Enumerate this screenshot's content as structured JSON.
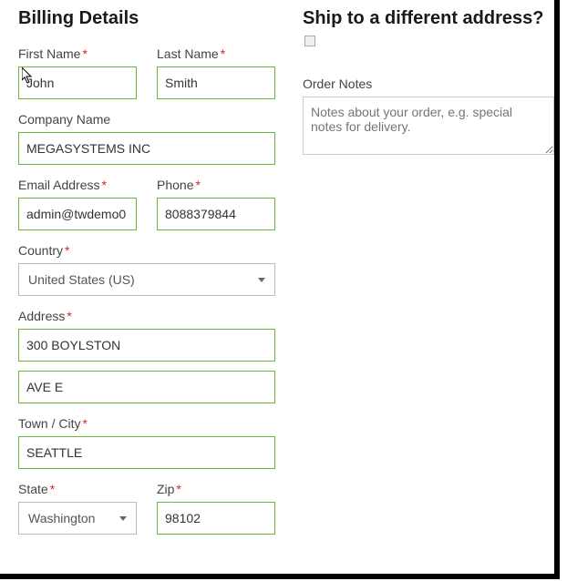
{
  "billing": {
    "heading": "Billing Details",
    "first_name": {
      "label": "First Name",
      "value": "John"
    },
    "last_name": {
      "label": "Last Name",
      "value": "Smith"
    },
    "company": {
      "label": "Company Name",
      "value": "MEGASYSTEMS INC"
    },
    "email": {
      "label": "Email Address",
      "value": "admin@twdemo0"
    },
    "phone": {
      "label": "Phone",
      "value": "8088379844"
    },
    "country": {
      "label": "Country",
      "selected": "United States (US)"
    },
    "address": {
      "label": "Address",
      "line1": "300 BOYLSTON",
      "line2": "AVE E"
    },
    "city": {
      "label": "Town / City",
      "value": "SEATTLE"
    },
    "state": {
      "label": "State",
      "selected": "Washington"
    },
    "zip": {
      "label": "Zip",
      "value": "98102"
    },
    "required_mark": "*"
  },
  "shipping": {
    "heading": "Ship to a different address?",
    "notes_label": "Order Notes",
    "notes_placeholder": "Notes about your order, e.g. special notes for delivery."
  }
}
